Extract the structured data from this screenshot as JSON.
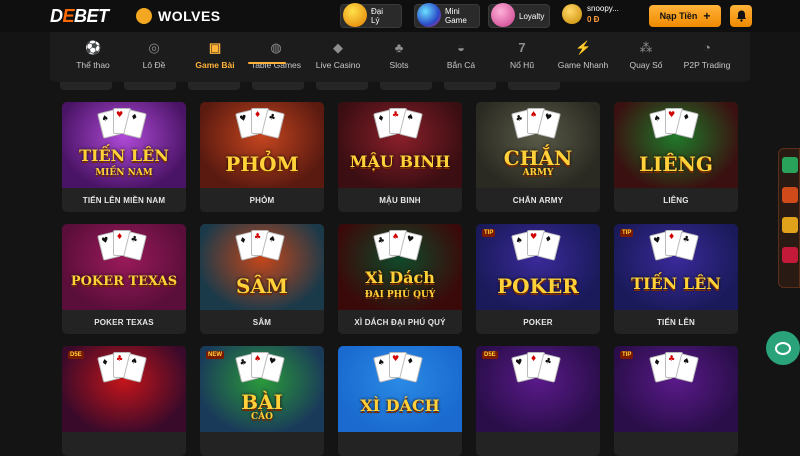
{
  "brand": {
    "logo_d": "D",
    "logo_e": "E",
    "logo_bet": "BET",
    "partner": "WOLVES"
  },
  "header": {
    "promos": [
      {
        "label": "Đại Lý",
        "icon": "agent-promo-icon"
      },
      {
        "label": "Mini Game",
        "icon": "minigame-promo-icon"
      },
      {
        "label": "Loyalty",
        "icon": "loyalty-promo-icon"
      }
    ],
    "user": {
      "name": "snoopy...",
      "balance": "0 Đ"
    },
    "deposit_label": "Nạp Tiền",
    "deposit_plus": "+"
  },
  "nav": {
    "items": [
      {
        "label": "Thể thao",
        "icon": "soccer-ball-icon",
        "glyph": "⚽"
      },
      {
        "label": "Lô Đề",
        "icon": "lottery-ball-icon",
        "glyph": "◎"
      },
      {
        "label": "Game Bài",
        "icon": "playing-cards-icon",
        "glyph": "▣",
        "active": true
      },
      {
        "label": "Table Games",
        "icon": "chips-icon",
        "glyph": "◍"
      },
      {
        "label": "Live Casino",
        "icon": "diamond-suit-icon",
        "glyph": "◆"
      },
      {
        "label": "Slots",
        "icon": "cherry-icon",
        "glyph": "♣"
      },
      {
        "label": "Bắn Cá",
        "icon": "fish-icon",
        "glyph": "◒"
      },
      {
        "label": "Nổ Hũ",
        "icon": "seven-icon",
        "glyph": "7"
      },
      {
        "label": "Game Nhanh",
        "icon": "lightning-icon",
        "glyph": "⚡"
      },
      {
        "label": "Quay Số",
        "icon": "balls-icon",
        "glyph": "⁂"
      },
      {
        "label": "P2P Trading",
        "icon": "trading-icon",
        "glyph": "◔"
      }
    ]
  },
  "games": [
    {
      "name": "TIẾN LÊN MIỀN NAM",
      "art_title": "TIẾN LÊN",
      "art_sub": "MIỀN NAM",
      "bg": "#4a1466",
      "accent": "#b04ad8",
      "tag": ""
    },
    {
      "name": "PHỎM",
      "art_title": "PHỎM",
      "art_sub": "",
      "bg": "#5a1a10",
      "accent": "#c4451f",
      "tag": ""
    },
    {
      "name": "MẬU BINH",
      "art_title": "MẬU BINH",
      "art_sub": "",
      "bg": "#3a0e12",
      "accent": "#8a1f2a",
      "tag": ""
    },
    {
      "name": "CHẮN ARMY",
      "art_title": "CHẮN",
      "art_sub": "ARMY",
      "bg": "#2a2a22",
      "accent": "#5a5a48",
      "tag": ""
    },
    {
      "name": "LIÊNG",
      "art_title": "LIÊNG",
      "art_sub": "",
      "bg": "#3a1010",
      "accent": "#1f7a2a",
      "tag": ""
    },
    {
      "name": "POKER TEXAS",
      "art_title": "POKER TEXAS",
      "art_sub": "",
      "bg": "#5a0e3a",
      "accent": "#9a1a5a",
      "tag": ""
    },
    {
      "name": "SÂM",
      "art_title": "SÂM",
      "art_sub": "",
      "bg": "#1a3a4a",
      "accent": "#c4461a",
      "tag": ""
    },
    {
      "name": "XÌ DÁCH ĐẠI PHÚ QUÝ",
      "art_title": "Xì Dách",
      "art_sub": "ĐẠI PHÚ QUÝ",
      "bg": "#3a0a0a",
      "accent": "#0f4a2a",
      "tag": ""
    },
    {
      "name": "POKER",
      "art_title": "POKER",
      "art_sub": "",
      "bg": "#1a1a5a",
      "accent": "#3a2a9a",
      "tag": "TIP"
    },
    {
      "name": "TIẾN LÊN",
      "art_title": "TIẾN LÊN",
      "art_sub": "",
      "bg": "#1a1a5a",
      "accent": "#3a2a9a",
      "tag": "TIP"
    },
    {
      "name": "",
      "art_title": "",
      "art_sub": "",
      "bg": "#3a0a2a",
      "accent": "#c4151a",
      "tag": "D5E"
    },
    {
      "name": "",
      "art_title": "BÀI",
      "art_sub": "CÀO",
      "bg": "#1a3a5a",
      "accent": "#2a9a3a",
      "tag": "NEW"
    },
    {
      "name": "",
      "art_title": "XÌ DÁCH",
      "art_sub": "",
      "bg": "#1a6acf",
      "accent": "#2a8ae4",
      "tag": ""
    },
    {
      "name": "",
      "art_title": "",
      "art_sub": "",
      "bg": "#2a0e4a",
      "accent": "#5a1a8a",
      "tag": "D5E"
    },
    {
      "name": "",
      "art_title": "",
      "art_sub": "",
      "bg": "#2a0e4a",
      "accent": "#5a1a8a",
      "tag": "TIP"
    }
  ],
  "chat": {
    "icon": "chat-bubble-icon"
  },
  "colors": {
    "accent": "#ffb23a",
    "background": "#141414",
    "card": "#232323"
  }
}
